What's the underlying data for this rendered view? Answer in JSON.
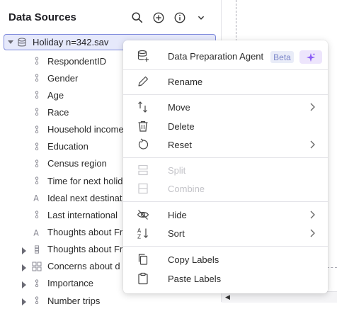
{
  "panel": {
    "title": "Data Sources",
    "root_label": "Holiday n=342.sav",
    "items": [
      {
        "label": "RespondentID",
        "icon": "numeric-icon",
        "expandable": false
      },
      {
        "label": "Gender",
        "icon": "numeric-icon",
        "expandable": false
      },
      {
        "label": "Age",
        "icon": "numeric-icon",
        "expandable": false
      },
      {
        "label": "Race",
        "icon": "numeric-icon",
        "expandable": false
      },
      {
        "label": "Household income",
        "icon": "numeric-icon",
        "expandable": false
      },
      {
        "label": "Education",
        "icon": "numeric-icon",
        "expandable": false
      },
      {
        "label": "Census region",
        "icon": "numeric-icon",
        "expandable": false
      },
      {
        "label": "Time for next holid",
        "icon": "numeric-icon",
        "expandable": false
      },
      {
        "label": "Ideal next destinat",
        "icon": "text-icon",
        "expandable": false
      },
      {
        "label": "Last international",
        "icon": "numeric-icon",
        "expandable": false
      },
      {
        "label": "Thoughts about Fr",
        "icon": "text-icon",
        "expandable": false
      },
      {
        "label": "Thoughts about Fr",
        "icon": "numeric-set-icon",
        "expandable": true
      },
      {
        "label": "Concerns about d",
        "icon": "grid-icon",
        "expandable": true
      },
      {
        "label": "Importance",
        "icon": "numeric-icon",
        "expandable": true
      },
      {
        "label": "Number trips",
        "icon": "numeric-icon",
        "expandable": true
      }
    ]
  },
  "menu": {
    "items": {
      "agent": "Data Preparation Agent",
      "beta": "Beta",
      "rename": "Rename",
      "move": "Move",
      "delete": "Delete",
      "reset": "Reset",
      "split": "Split",
      "combine": "Combine",
      "hide": "Hide",
      "sort": "Sort",
      "copy_labels": "Copy Labels",
      "paste_labels": "Paste Labels"
    }
  },
  "colors": {
    "selection_bg": "#e6e9fb",
    "selection_border": "#7f8bdc",
    "beta_text": "#7c86c9",
    "sparkle": "#8b5cf6"
  }
}
